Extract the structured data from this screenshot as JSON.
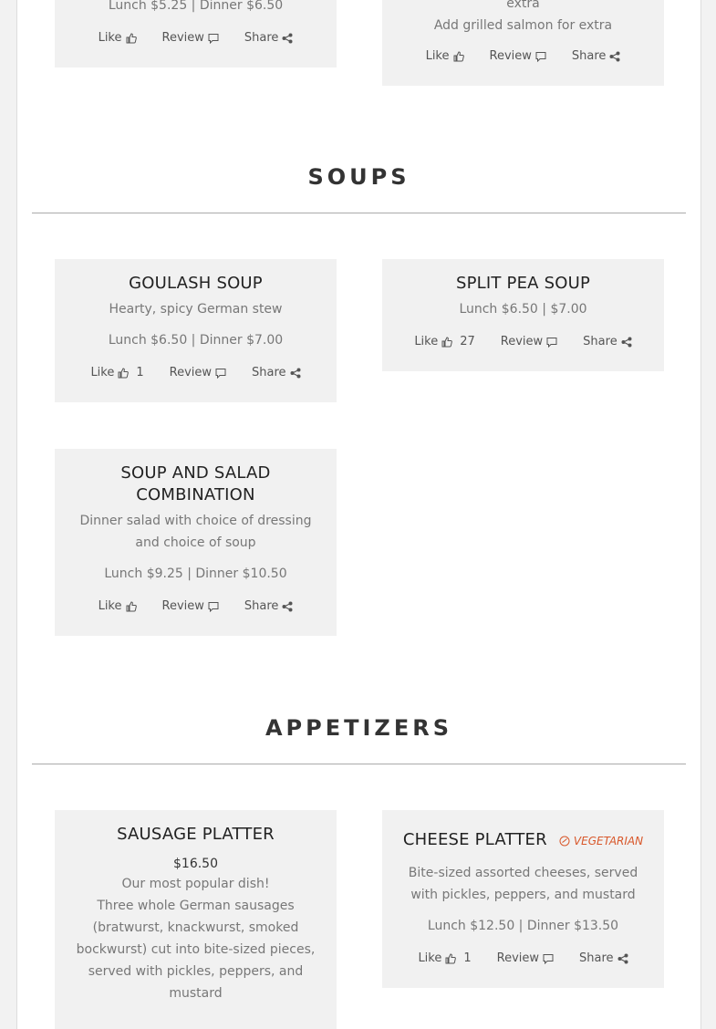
{
  "actions": {
    "like": "Like",
    "review": "Review",
    "share": "Share"
  },
  "top_cards": [
    {
      "price": "Lunch $5.25 | Dinner $6.50"
    },
    {
      "desc_line1": "extra",
      "desc_line2": "Add grilled salmon for extra"
    }
  ],
  "soups": {
    "heading": "SOUPS",
    "items": [
      {
        "name": "GOULASH SOUP",
        "desc": "Hearty, spicy German stew",
        "price": "Lunch $6.50 | Dinner $7.00",
        "likes": "1"
      },
      {
        "name": "SPLIT PEA SOUP",
        "price": "Lunch $6.50 | $7.00",
        "likes": "27"
      },
      {
        "name_line1": "SOUP AND SALAD",
        "name_line2": "COMBINATION",
        "desc_line1": "Dinner salad with choice of dressing",
        "desc_line2": "and choice of soup",
        "price": "Lunch $9.25 | Dinner $10.50"
      }
    ]
  },
  "appetizers": {
    "heading": "APPETIZERS",
    "items": [
      {
        "name": "SAUSAGE PLATTER",
        "price": "$16.50",
        "desc_lines": [
          "Our most popular dish!",
          "Three whole German sausages",
          "(bratwurst, knackwurst, smoked",
          "bockwurst) cut into bite-sized pieces,",
          "served with pickles, peppers, and",
          "mustard"
        ]
      },
      {
        "name": "CHEESE PLATTER",
        "badge": "VEGETARIAN",
        "desc_line1": "Bite-sized assorted cheeses, served",
        "desc_line2": "with pickles, peppers, and mustard",
        "price": "Lunch $12.50 | Dinner $13.50",
        "likes": "1"
      }
    ]
  },
  "colors": {
    "accent_vegetarian": "#d8572a",
    "card_bg": "#f1f1f1"
  }
}
